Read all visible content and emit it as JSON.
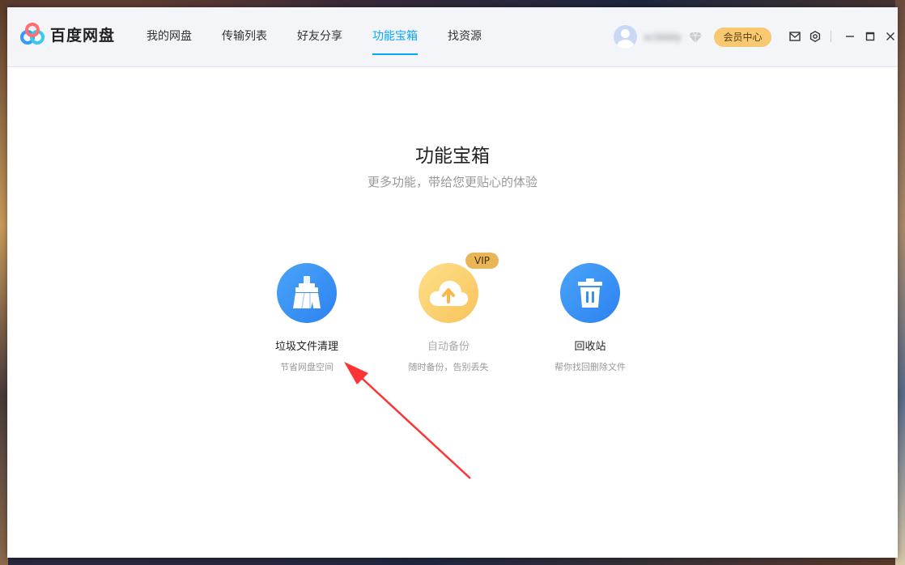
{
  "app": {
    "title": "百度网盘",
    "brand_color": "#06a7ff"
  },
  "nav": {
    "items": [
      {
        "label": "我的网盘",
        "active": false
      },
      {
        "label": "传输列表",
        "active": false
      },
      {
        "label": "好友分享",
        "active": false
      },
      {
        "label": "功能宝箱",
        "active": true
      },
      {
        "label": "找资源",
        "active": false
      }
    ]
  },
  "user": {
    "name": "xcldddy"
  },
  "toolbar": {
    "vip_center_label": "会员中心",
    "icons": [
      "mail-icon",
      "settings-icon",
      "minimize-icon",
      "maximize-icon",
      "close-icon"
    ]
  },
  "page": {
    "title": "功能宝箱",
    "subtitle": "更多功能，带给您更贴心的体验"
  },
  "tools": [
    {
      "name": "垃圾文件清理",
      "desc": "节省网盘空间",
      "icon": "broom-icon",
      "enabled": true
    },
    {
      "name": "自动备份",
      "desc": "随时备份，告别丢失",
      "icon": "cloud-upload-icon",
      "enabled": false,
      "badge": "VIP"
    },
    {
      "name": "回收站",
      "desc": "帮你找回删除文件",
      "icon": "trash-icon",
      "enabled": true
    }
  ],
  "annotation": {
    "arrow_color": "#ff3333",
    "points_to": "垃圾文件清理"
  }
}
